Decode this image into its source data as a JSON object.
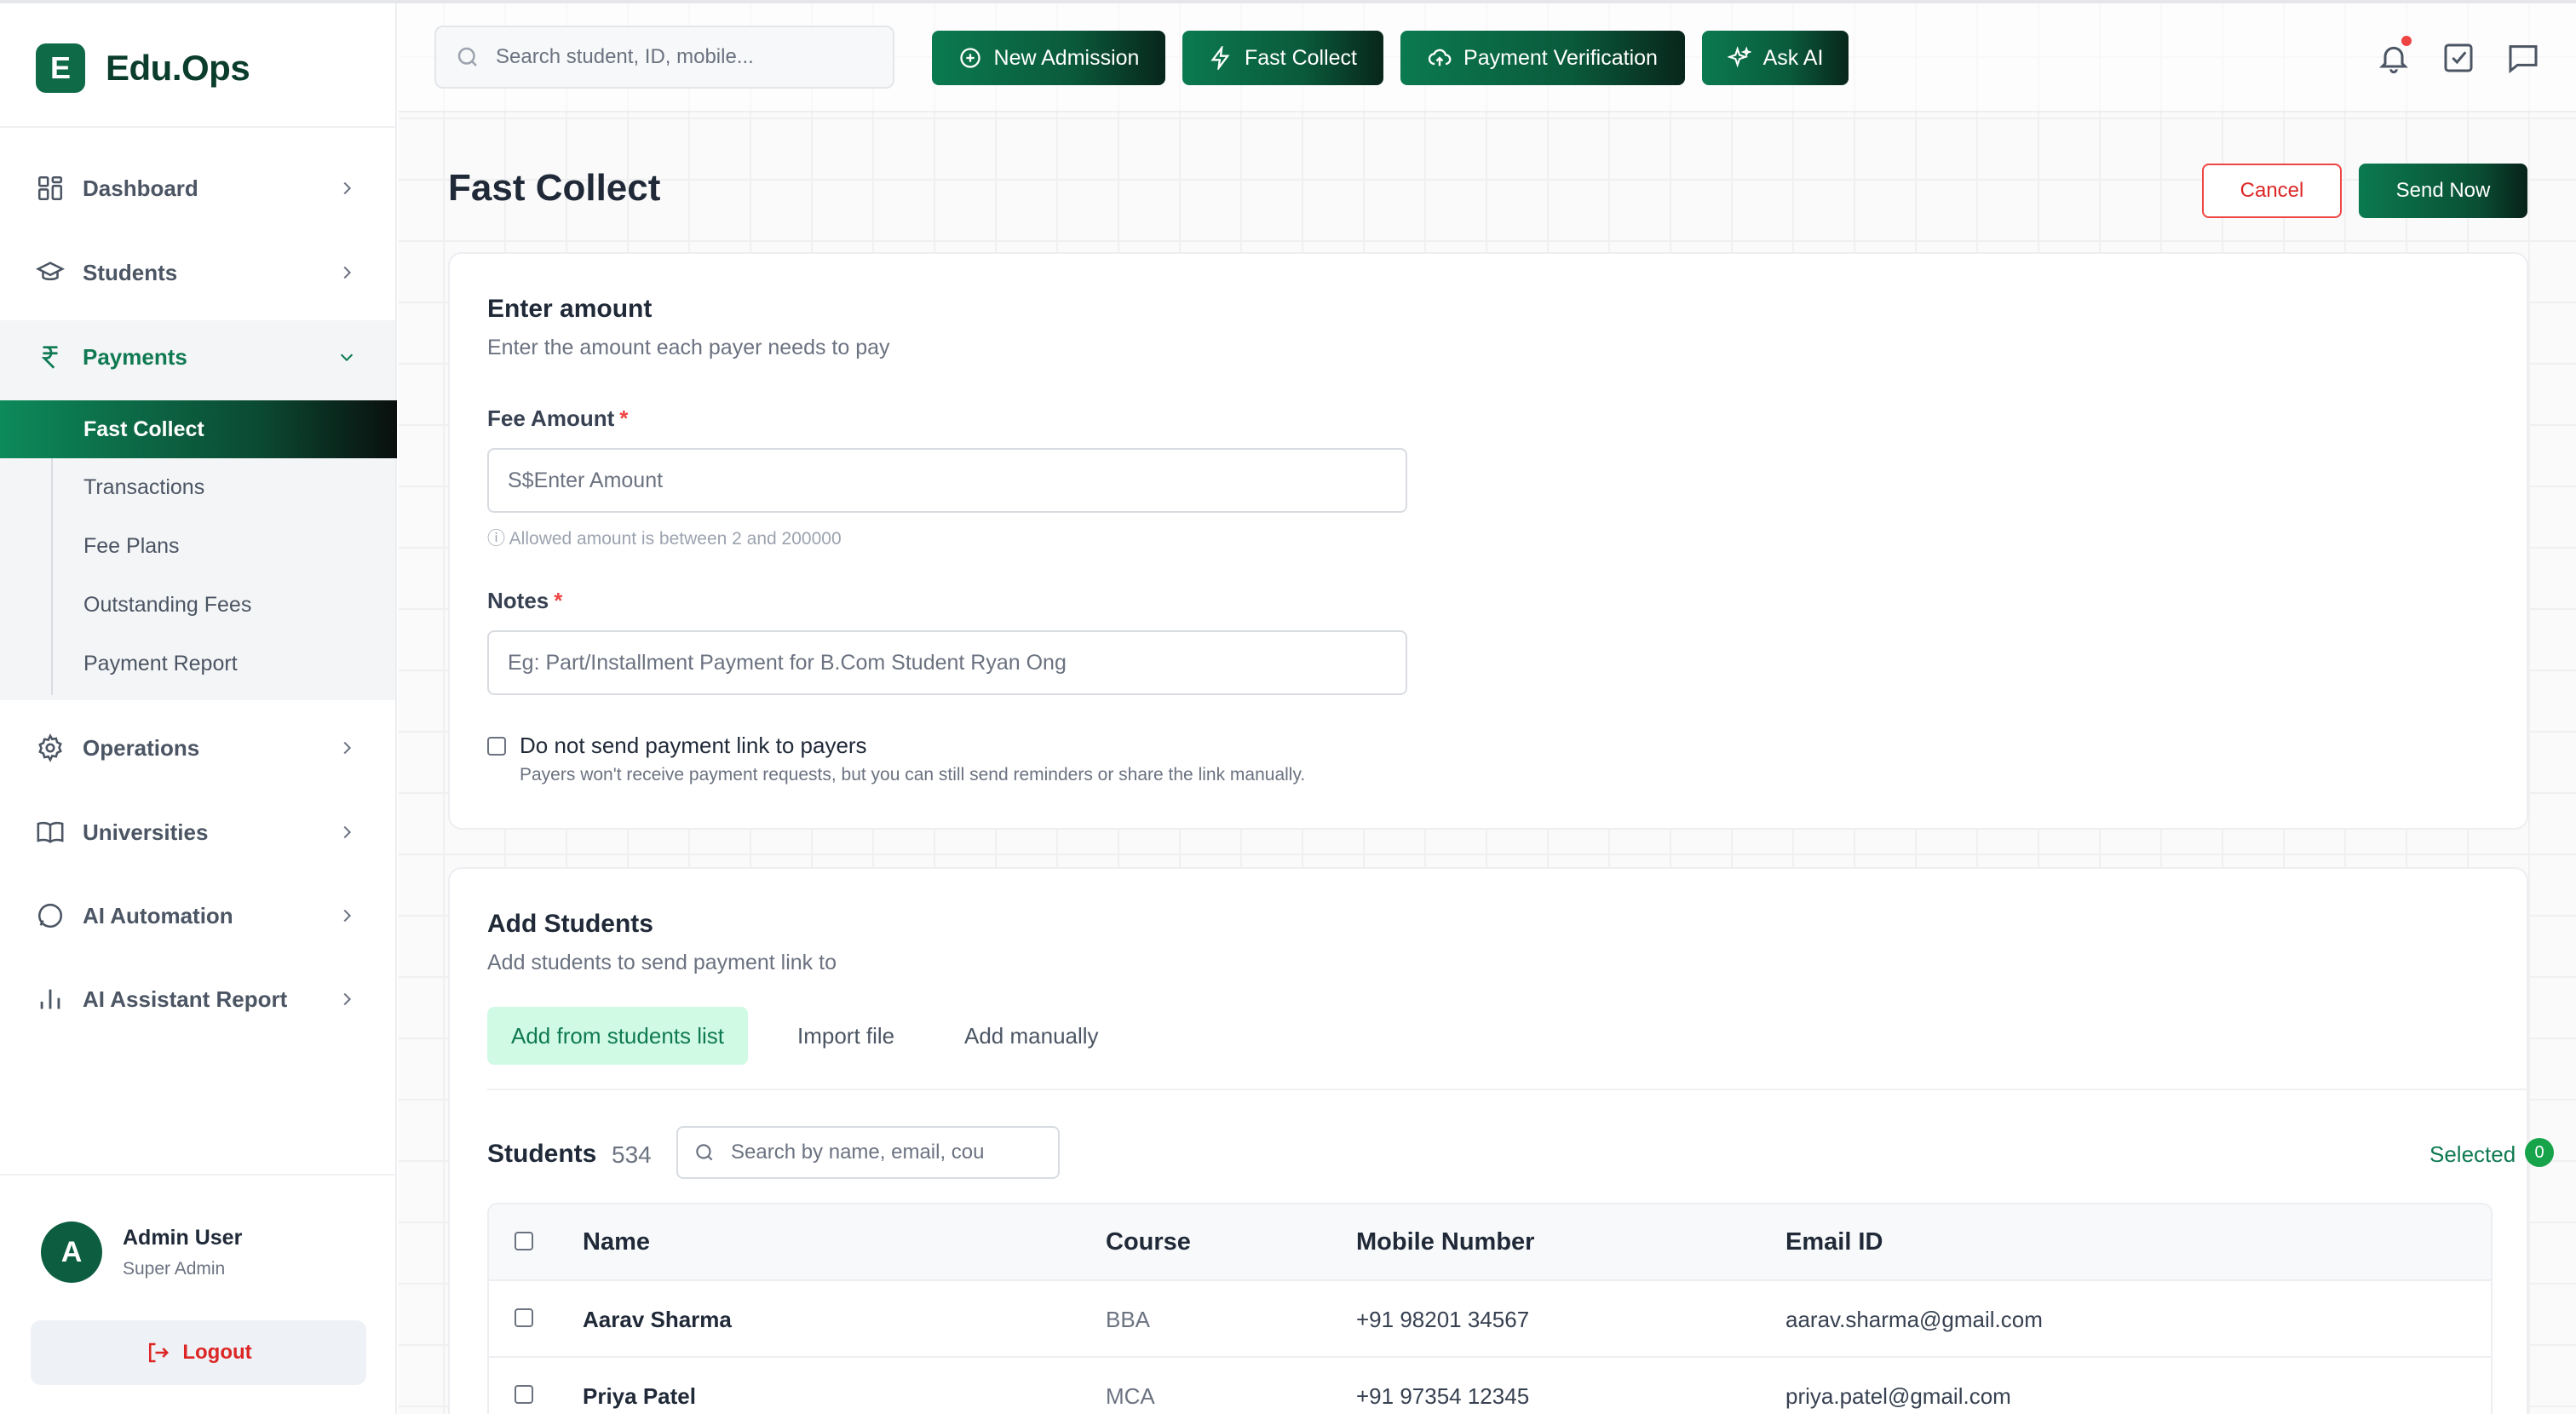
{
  "app": {
    "logo_letter": "E",
    "name": "Edu.Ops"
  },
  "sidebar": {
    "items": [
      {
        "label": "Dashboard"
      },
      {
        "label": "Students"
      },
      {
        "label": "Payments"
      },
      {
        "label": "Operations"
      },
      {
        "label": "Universities"
      },
      {
        "label": "AI Automation"
      },
      {
        "label": "AI Assistant Report"
      }
    ],
    "payments_sub": [
      {
        "label": "Fast Collect"
      },
      {
        "label": "Transactions"
      },
      {
        "label": "Fee Plans"
      },
      {
        "label": "Outstanding Fees"
      },
      {
        "label": "Payment Report"
      }
    ],
    "user": {
      "initial": "A",
      "name": "Admin User",
      "role": "Super Admin"
    },
    "logout_label": "Logout"
  },
  "topbar": {
    "search_placeholder": "Search student, ID, mobile...",
    "buttons": [
      {
        "label": "New Admission",
        "icon": "plus-circle-icon"
      },
      {
        "label": "Fast Collect",
        "icon": "lightning-icon"
      },
      {
        "label": "Payment Verification",
        "icon": "cloud-upload-icon"
      },
      {
        "label": "Ask AI",
        "icon": "sparkles-icon"
      }
    ]
  },
  "page": {
    "title": "Fast Collect",
    "cancel_label": "Cancel",
    "send_label": "Send Now"
  },
  "amount_card": {
    "title": "Enter amount",
    "subtitle": "Enter the amount each payer needs to pay",
    "fee_label": "Fee Amount",
    "required_mark": "*",
    "fee_placeholder": "S$Enter Amount",
    "fee_hint": "ⓘ Allowed amount is between 2 and 200000",
    "notes_label": "Notes",
    "notes_placeholder": "Eg: Part/Installment Payment for B.Com Student Ryan Ong",
    "checkbox_label": "Do not send payment link to payers",
    "checkbox_hint": "Payers won't receive payment requests, but you can still send reminders or share the link manually."
  },
  "students_card": {
    "title": "Add Students",
    "subtitle": "Add students to send payment link to",
    "tabs": [
      {
        "label": "Add from students list"
      },
      {
        "label": "Import file"
      },
      {
        "label": "Add manually"
      }
    ],
    "list_label": "Students",
    "count": "534",
    "search_placeholder": "Search by name, email, cou",
    "selected_label": "Selected",
    "selected_count": "0",
    "columns": [
      "Name",
      "Course",
      "Mobile Number",
      "Email ID"
    ],
    "rows": [
      {
        "name": "Aarav Sharma",
        "course": "BBA",
        "mobile": "+91 98201 34567",
        "email": "aarav.sharma@gmail.com"
      },
      {
        "name": "Priya Patel",
        "course": "MCA",
        "mobile": "+91 97354 12345",
        "email": "priya.patel@gmail.com"
      }
    ]
  },
  "colors": {
    "brand": "#0f7a52",
    "brand_dark": "#0b3d2c",
    "danger": "#dc2626"
  }
}
